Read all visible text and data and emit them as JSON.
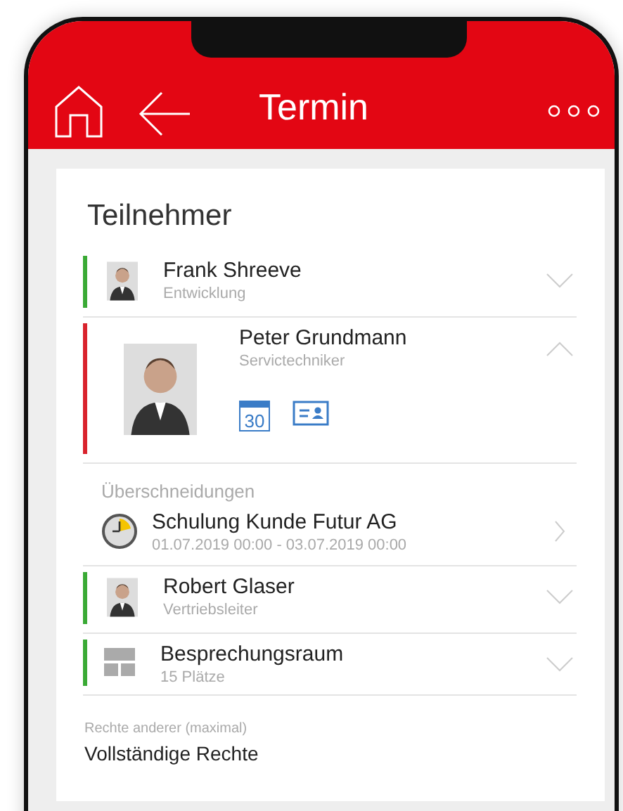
{
  "header": {
    "title": "Termin"
  },
  "card": {
    "heading": "Teilnehmer",
    "participants": [
      {
        "kind": "person",
        "name": "Frank Shreeve",
        "role": "Entwicklung",
        "color": "#3aaa35",
        "expanded": false
      },
      {
        "kind": "person",
        "name": "Peter Grundmann",
        "role": "Servictechniker",
        "color": "#d9232d",
        "expanded": true,
        "calendar_day": "30",
        "overlaps": {
          "heading": "Überschneidungen",
          "items": [
            {
              "title": "Schulung Kunde Futur AG",
              "time": "01.07.2019 00:00 - 03.07.2019 00:00"
            }
          ]
        }
      },
      {
        "kind": "person",
        "name": "Robert Glaser",
        "role": "Vertriebsleiter",
        "color": "#3aaa35",
        "expanded": false
      },
      {
        "kind": "room",
        "name": "Besprechungsraum",
        "role": "15 Plätze",
        "color": "#3aaa35",
        "expanded": false
      }
    ],
    "rights": {
      "label": "Rechte anderer (maximal)",
      "value": "Vollständige Rechte"
    }
  }
}
